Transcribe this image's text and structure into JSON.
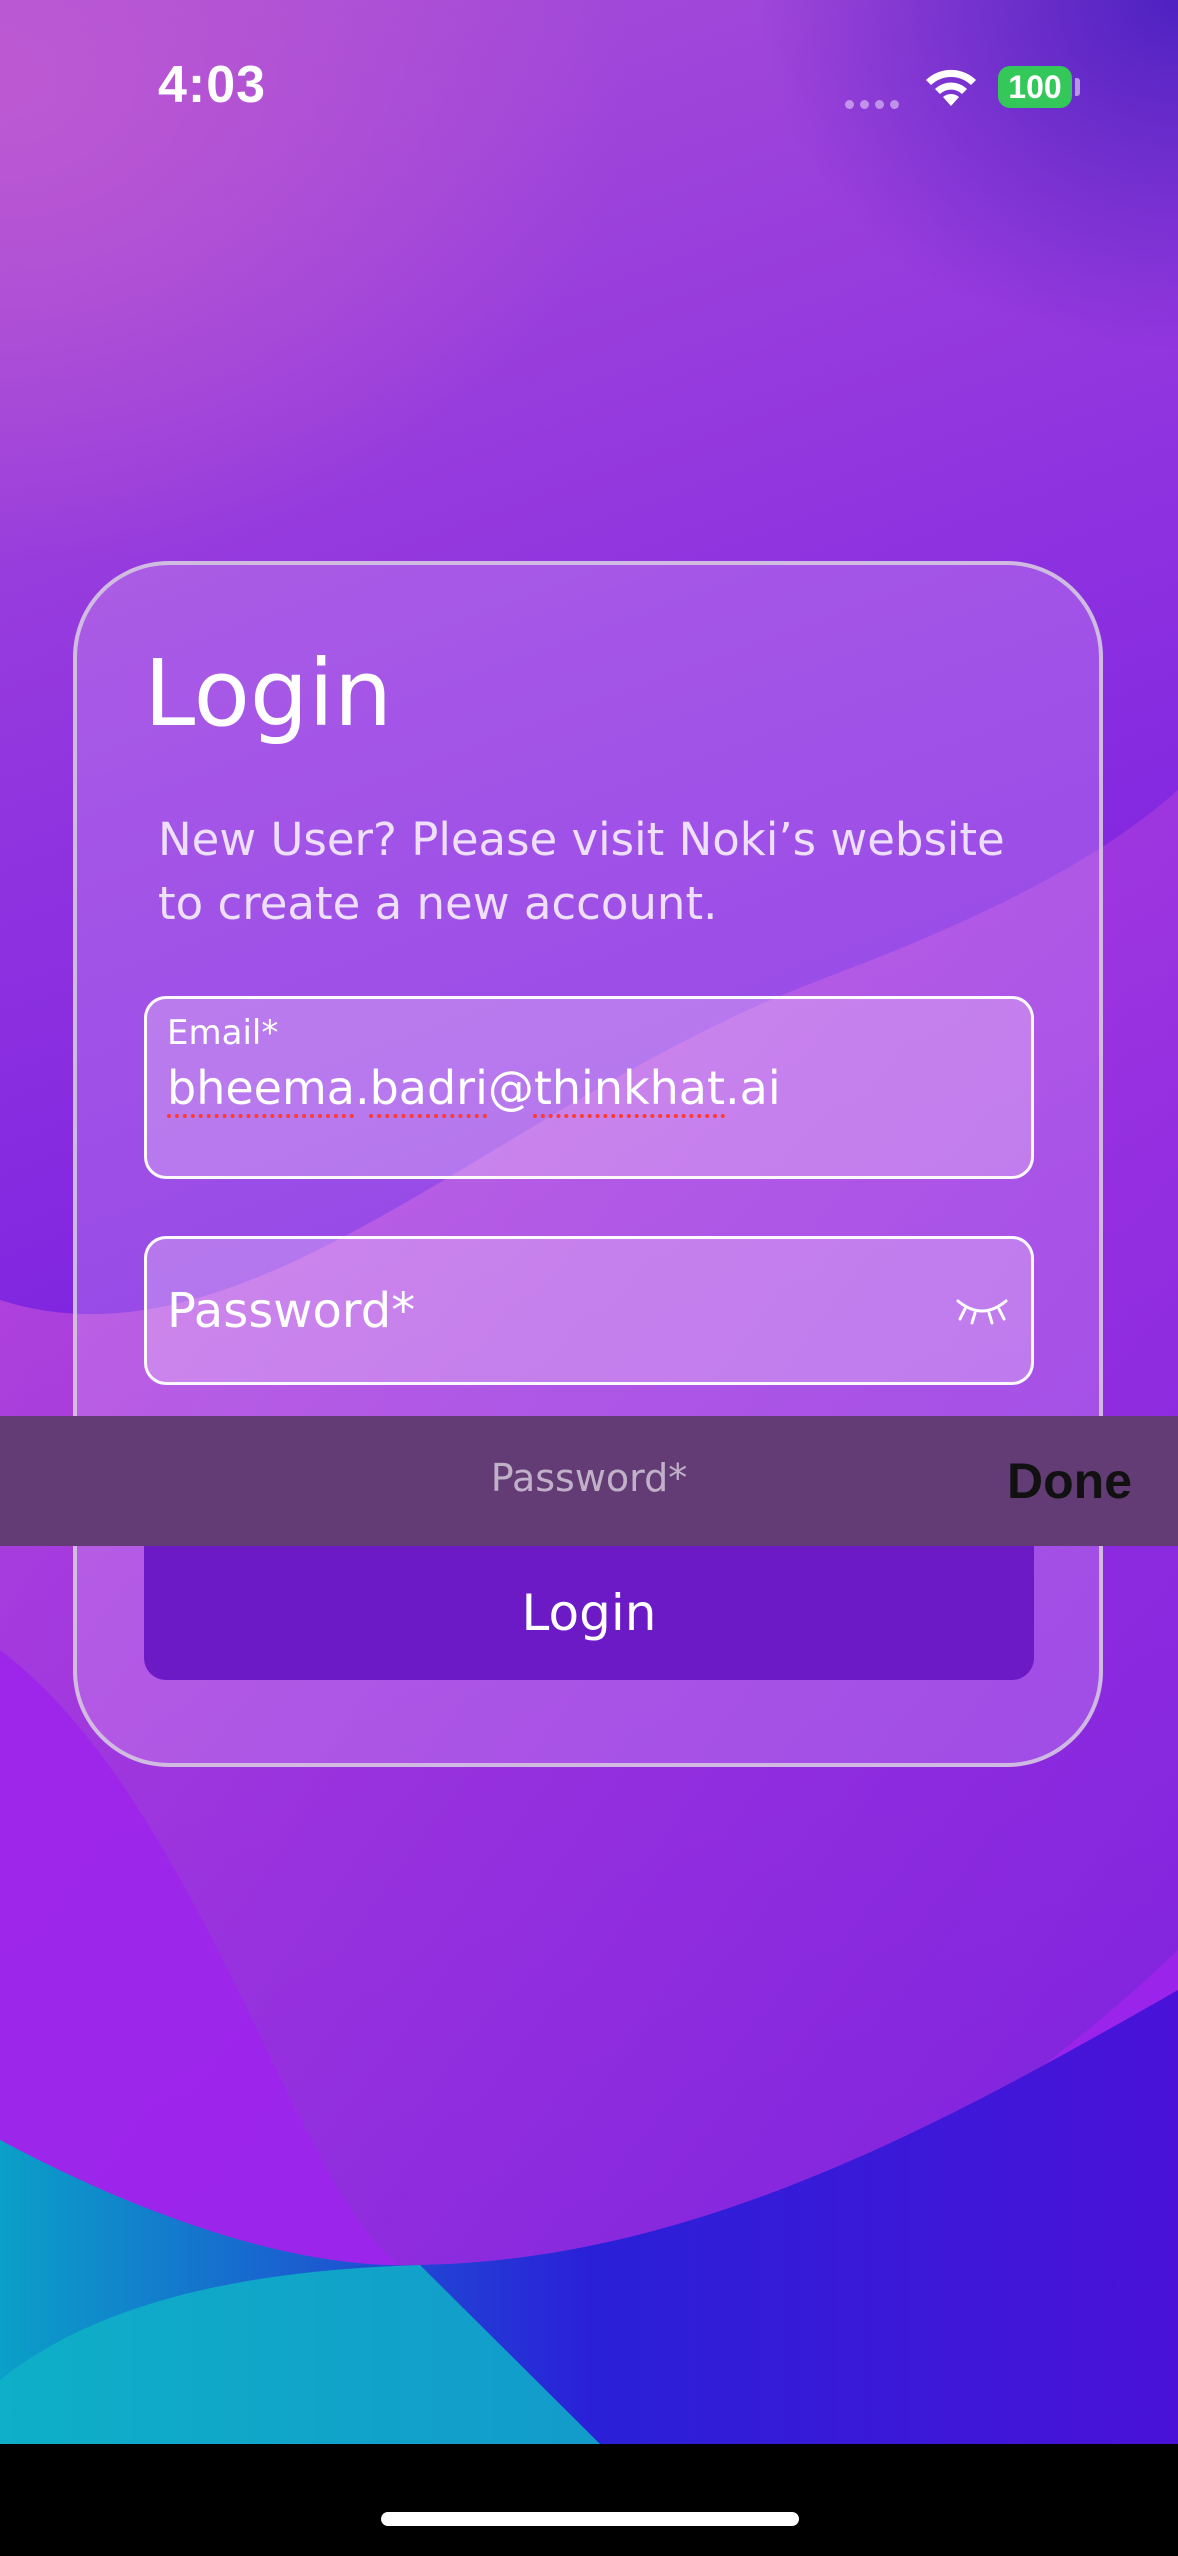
{
  "status_bar": {
    "time": "4:03",
    "battery": "100",
    "wifi_icon": "wifi-icon",
    "signal_icon": "cellular-signal-icon"
  },
  "login_card": {
    "title": "Login",
    "subtitle": "New User? Please visit Noki’s website to create a new account.",
    "email": {
      "label": "Email*",
      "value_parts": [
        "bheema",
        ".",
        "badri",
        "@",
        "thinkhat",
        ".ai"
      ]
    },
    "password": {
      "placeholder": "Password*",
      "toggle_icon": "eye-closed-icon"
    },
    "login_button": "Login"
  },
  "keyboard_accessory": {
    "field_label": "Password*",
    "done": "Done"
  },
  "colors": {
    "accent_button": "#6c1ac6",
    "battery": "#34c759",
    "spellcheck": "#ff3b30",
    "accessory_bar": "#633c76"
  }
}
